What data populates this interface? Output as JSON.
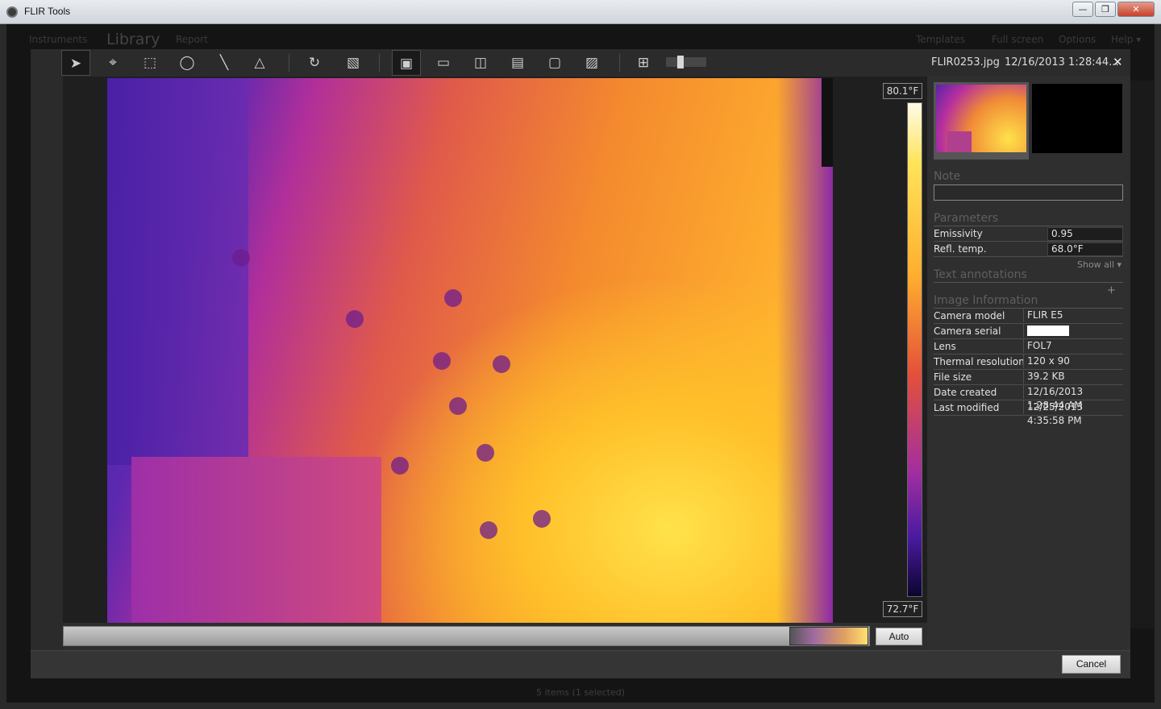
{
  "window": {
    "title": "FLIR Tools",
    "buttons": {
      "minimize": "—",
      "maximize": "❐",
      "close": "✕"
    }
  },
  "background": {
    "nav": [
      "Instruments",
      "Library",
      "Report"
    ],
    "nav_right": [
      "Templates",
      "Full screen",
      "Options",
      "Help ▾"
    ],
    "status": "5 items  (1 selected)"
  },
  "toolbar": {
    "tools": [
      {
        "name": "select-tool",
        "glyph": "➤"
      },
      {
        "name": "spot-tool",
        "glyph": "⌖"
      },
      {
        "name": "box-tool",
        "glyph": "⬚"
      },
      {
        "name": "circle-tool",
        "glyph": "◯"
      },
      {
        "name": "line-tool",
        "glyph": "╲"
      },
      {
        "name": "delta-tool",
        "glyph": "△"
      },
      {
        "name": "rotate-tool",
        "glyph": "↻"
      },
      {
        "name": "palette-tool",
        "glyph": "▧"
      }
    ],
    "modes": [
      "▣",
      "▭",
      "◫",
      "▤",
      "▢",
      "▨"
    ],
    "fit_glyph": "⊞",
    "filename": "FLIR0253.jpg",
    "datetime": "12/16/2013 1:28:44...",
    "close": "✕"
  },
  "scale": {
    "max": "80.1°F",
    "min": "72.7°F"
  },
  "buttons": {
    "auto": "Auto",
    "cancel": "Cancel"
  },
  "panel": {
    "note_label": "Note",
    "parameters_label": "Parameters",
    "parameters": [
      {
        "key": "Emissivity",
        "value": "0.95"
      },
      {
        "key": "Refl. temp.",
        "value": "68.0°F"
      }
    ],
    "show_all": "Show all ▾",
    "text_annotations_label": "Text annotations",
    "plus": "+",
    "image_info_label": "Image Information",
    "image_info": [
      {
        "key": "Camera model",
        "value": "FLIR E5"
      },
      {
        "key": "Camera serial",
        "value": ""
      },
      {
        "key": "Lens",
        "value": "FOL7"
      },
      {
        "key": "Thermal resolution",
        "value": "120 x 90"
      },
      {
        "key": "File size",
        "value": "39.2 KB"
      },
      {
        "key": "Date created",
        "value": "12/16/2013 1:28:44 AM"
      },
      {
        "key": "Last modified",
        "value": "12/25/2013 4:35:58 PM"
      }
    ]
  }
}
